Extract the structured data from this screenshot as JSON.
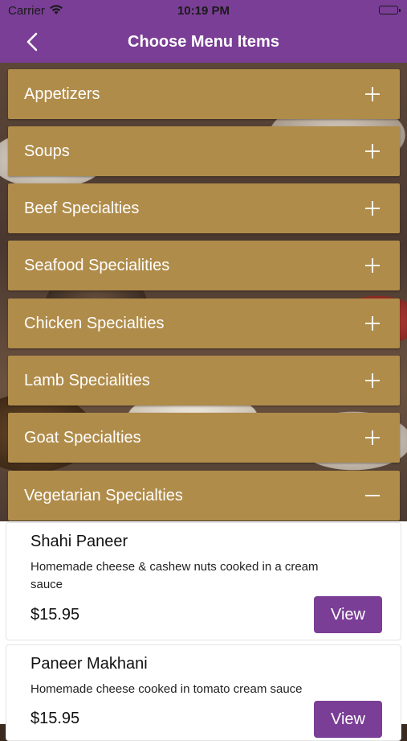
{
  "status_bar": {
    "carrier": "Carrier",
    "time": "10:19 PM"
  },
  "nav": {
    "title": "Choose Menu Items",
    "back_icon": "chevron-left-icon"
  },
  "colors": {
    "primary": "#7a3e96",
    "category_bg": "#b08c4a",
    "text_on_primary": "#ffffff"
  },
  "categories": [
    {
      "label": "Appetizers",
      "expanded": false
    },
    {
      "label": "Soups",
      "expanded": false
    },
    {
      "label": "Beef Specialties",
      "expanded": false
    },
    {
      "label": "Seafood Specialities",
      "expanded": false
    },
    {
      "label": "Chicken Specialties",
      "expanded": false
    },
    {
      "label": "Lamb Specialities",
      "expanded": false
    },
    {
      "label": "Goat Specialties",
      "expanded": false
    },
    {
      "label": "Vegetarian Specialties",
      "expanded": true
    }
  ],
  "menu_items": [
    {
      "name": "Shahi Paneer",
      "description": "Homemade cheese & cashew nuts cooked in a cream sauce",
      "price": "$15.95",
      "button_label": "View"
    },
    {
      "name": "Paneer Makhani",
      "description": "Homemade cheese cooked in tomato cream sauce",
      "price": "$15.95",
      "button_label": "View"
    }
  ]
}
